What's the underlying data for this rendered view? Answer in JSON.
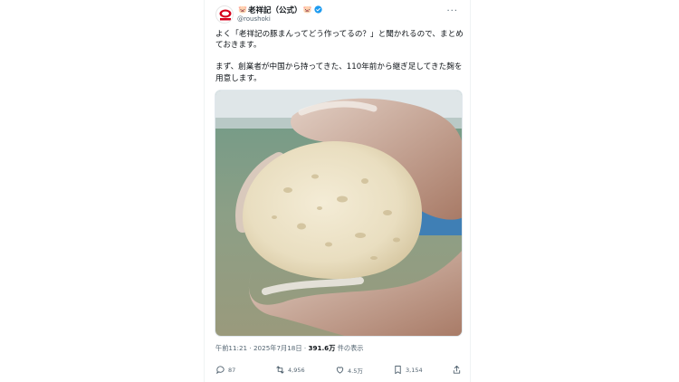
{
  "post": {
    "display_name": "老祥記（公式）",
    "pig_left": "🐷",
    "pig_right": "🐷",
    "handle": "@roushoki",
    "more_label": "···",
    "text_line1": "よく「老祥記の豚まんってどう作ってるの？」と聞かれるので、まとめておきます。",
    "text_line2": "まず、創業者が中国から持ってきた、110年前から継ぎ足してきた麹を用意します。",
    "time": "午前11:21",
    "dot": "·",
    "date": "2025年7月18日",
    "views_count": "391.6万",
    "views_label": "件の表示"
  },
  "actions": {
    "reply_count": "87",
    "repost_count": "4,956",
    "like_count": "4.5万",
    "bookmark_count": "3,154"
  },
  "colors": {
    "verified": "#1d9bf0",
    "secondary_text": "#536471",
    "brand_red": "#d6001c"
  },
  "icons": [
    "verified-badge-icon",
    "more-icon",
    "reply-icon",
    "repost-icon",
    "like-icon",
    "bookmark-icon",
    "share-icon"
  ]
}
